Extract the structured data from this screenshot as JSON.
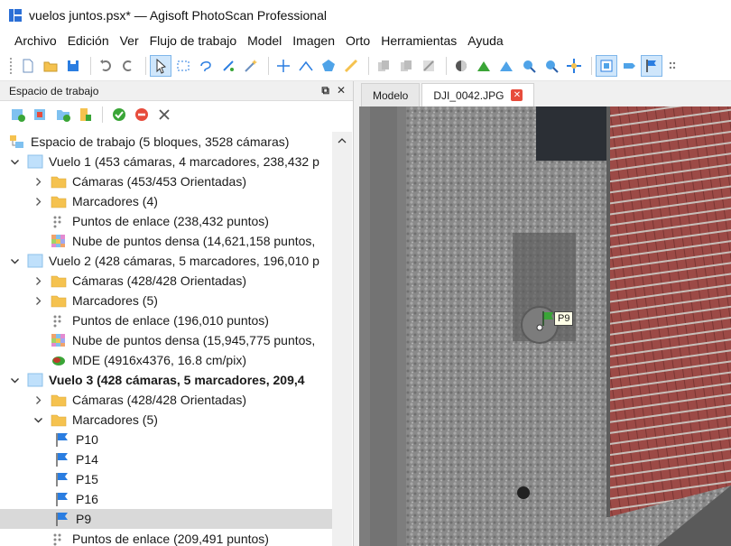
{
  "window": {
    "title": "vuelos juntos.psx* — Agisoft PhotoScan Professional"
  },
  "menubar": [
    "Archivo",
    "Edición",
    "Ver",
    "Flujo de trabajo",
    "Model",
    "Imagen",
    "Orto",
    "Herramientas",
    "Ayuda"
  ],
  "toolbar": {
    "icons": [
      "new-icon",
      "open-icon",
      "save-icon",
      "undo-icon",
      "redo-icon",
      "navigation-icon",
      "rectangle-selection-icon",
      "free-form-selection-icon",
      "intelligent-scissors-icon",
      "magic-wand-icon",
      "move-region-icon",
      "ruler-icon",
      "shape-icon",
      "draw-line-icon",
      "copy-icon",
      "paste-icon",
      "delete-icon",
      "shading-icon",
      "reset-view-icon",
      "rotate-icon",
      "zoom-in-icon",
      "zoom-out-icon",
      "move-icon",
      "photo-view-icon",
      "masks-icon",
      "markers-icon",
      "grid-icon"
    ]
  },
  "workspace": {
    "header": "Espacio de trabajo",
    "root": "Espacio de trabajo (5 bloques, 3528 cámaras)",
    "rows": [
      {
        "label": "Vuelo 1 (453 cámaras, 4 marcadores, 238,432 p",
        "level": 0,
        "caret": "down",
        "icon": "chunk",
        "bold": false
      },
      {
        "label": "Cámaras (453/453 Orientadas)",
        "level": 1,
        "caret": "right",
        "icon": "folder",
        "bold": false
      },
      {
        "label": "Marcadores (4)",
        "level": 1,
        "caret": "right",
        "icon": "folder",
        "bold": false
      },
      {
        "label": "Puntos de enlace (238,432 puntos)",
        "level": 1,
        "caret": "none",
        "icon": "points",
        "bold": false
      },
      {
        "label": "Nube de puntos densa (14,621,158 puntos,",
        "level": 1,
        "caret": "none",
        "icon": "dense",
        "bold": false
      },
      {
        "label": "Vuelo 2 (428 cámaras, 5 marcadores, 196,010 p",
        "level": 0,
        "caret": "down",
        "icon": "chunk",
        "bold": false
      },
      {
        "label": "Cámaras (428/428 Orientadas)",
        "level": 1,
        "caret": "right",
        "icon": "folder",
        "bold": false
      },
      {
        "label": "Marcadores (5)",
        "level": 1,
        "caret": "right",
        "icon": "folder",
        "bold": false
      },
      {
        "label": "Puntos de enlace (196,010 puntos)",
        "level": 1,
        "caret": "none",
        "icon": "points",
        "bold": false
      },
      {
        "label": "Nube de puntos densa (15,945,775 puntos,",
        "level": 1,
        "caret": "none",
        "icon": "dense",
        "bold": false
      },
      {
        "label": "MDE (4916x4376, 16.8 cm/pix)",
        "level": 1,
        "caret": "none",
        "icon": "dem",
        "bold": false
      },
      {
        "label": "Vuelo 3 (428 cámaras, 5 marcadores, 209,4",
        "level": 0,
        "caret": "down",
        "icon": "chunk",
        "bold": true
      },
      {
        "label": "Cámaras (428/428 Orientadas)",
        "level": 1,
        "caret": "right",
        "icon": "folder",
        "bold": false
      },
      {
        "label": "Marcadores (5)",
        "level": 1,
        "caret": "down",
        "icon": "folder",
        "bold": false
      },
      {
        "label": "P10",
        "level": 2,
        "caret": "none",
        "icon": "flag",
        "bold": false
      },
      {
        "label": "P14",
        "level": 2,
        "caret": "none",
        "icon": "flag",
        "bold": false
      },
      {
        "label": "P15",
        "level": 2,
        "caret": "none",
        "icon": "flag",
        "bold": false
      },
      {
        "label": "P16",
        "level": 2,
        "caret": "none",
        "icon": "flag",
        "bold": false
      },
      {
        "label": "P9",
        "level": 2,
        "caret": "none",
        "icon": "flag",
        "bold": false,
        "selected": true
      },
      {
        "label": "Puntos de enlace (209,491 puntos)",
        "level": 1,
        "caret": "none",
        "icon": "points",
        "bold": false
      }
    ]
  },
  "viewport": {
    "tabs": [
      {
        "label": "Modelo",
        "active": false
      },
      {
        "label": "DJI_0042.JPG",
        "active": true,
        "closable": true
      }
    ],
    "marker_label": "P9"
  },
  "colors": {
    "selection": "#d9d9d9",
    "folder": "#f5c24f",
    "flag": "#2a7de1",
    "marker_green": "#3aa537",
    "close_red": "#e74c3c"
  }
}
